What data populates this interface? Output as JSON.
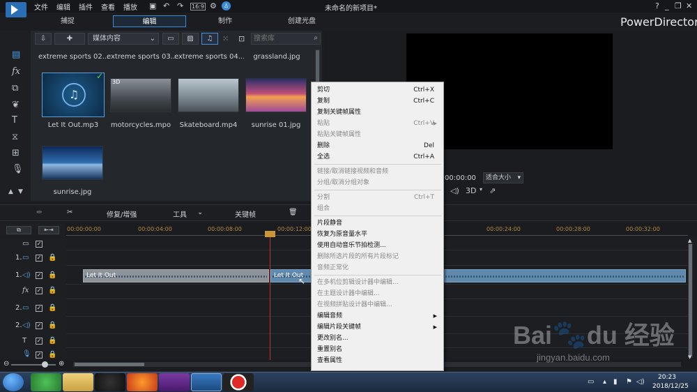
{
  "titlebar": {
    "menus": [
      "文件",
      "编辑",
      "插件",
      "查看",
      "播放"
    ],
    "doc_title": "未命名的新项目*",
    "brand": "PowerDirector",
    "ratio_label": "16:9"
  },
  "mode_tabs": [
    "捕捉",
    "编辑",
    "制作",
    "创建光盘"
  ],
  "library": {
    "content_dropdown": "媒体内容",
    "search_placeholder": "搜索库",
    "top_labels": [
      "extreme sports 02....",
      "extreme sports 03....",
      "extreme sports 04....",
      "grassland.jpg"
    ],
    "items": [
      {
        "label": "Let It Out.mp3",
        "kind": "audio"
      },
      {
        "label": "motorcycles.mpo",
        "kind": "video",
        "badge": "3D"
      },
      {
        "label": "Skateboard.mp4",
        "kind": "video"
      },
      {
        "label": "sunrise 01.jpg",
        "kind": "image"
      },
      {
        "label": "sunrise.jpg",
        "kind": "image"
      }
    ]
  },
  "preview": {
    "timecode": "00:00:00",
    "fit_label": "适合大小",
    "mode_3d": "3D"
  },
  "edit_toolbar": {
    "fix_label": "修复/增强",
    "tools_label": "工具",
    "keyframe_label": "关键帧"
  },
  "timeline": {
    "ruler": [
      "00:00:00:00",
      "00:00:04:00",
      "00:00:08:00",
      "00:00:12:00",
      "00:00:24:00",
      "00:00:28:00",
      "00:00:32:00"
    ],
    "tracks": [
      {
        "num": "",
        "icon": "▭"
      },
      {
        "num": "1.",
        "icon": "▭"
      },
      {
        "num": "1.",
        "icon": "◁)"
      },
      {
        "num": "",
        "icon": "fx"
      },
      {
        "num": "2.",
        "icon": "▭"
      },
      {
        "num": "2.",
        "icon": "◁)"
      },
      {
        "num": "",
        "icon": "T"
      },
      {
        "num": "",
        "icon": "🎙"
      },
      {
        "num": "",
        "icon": "♪"
      }
    ],
    "clip1_label": "Let It Out",
    "clip2_label": "Let It Out"
  },
  "context_menu": {
    "items": [
      {
        "label": "剪切",
        "shortcut": "Ctrl+X",
        "disabled": false
      },
      {
        "label": "复制",
        "shortcut": "Ctrl+C",
        "disabled": false
      },
      {
        "label": "复制关键帧属性",
        "shortcut": "",
        "disabled": false
      },
      {
        "label": "粘贴",
        "shortcut": "Ctrl+V",
        "disabled": true,
        "submenu": true
      },
      {
        "label": "粘贴关键帧属性",
        "shortcut": "",
        "disabled": true
      },
      {
        "label": "删除",
        "shortcut": "Del",
        "disabled": false
      },
      {
        "label": "全选",
        "shortcut": "Ctrl+A",
        "disabled": false
      },
      {
        "sep": true
      },
      {
        "label": "链接/取消链接视频和音频",
        "shortcut": "",
        "disabled": true
      },
      {
        "label": "分组/取消分组对象",
        "shortcut": "",
        "disabled": true
      },
      {
        "sep": true
      },
      {
        "label": "分割",
        "shortcut": "Ctrl+T",
        "disabled": true
      },
      {
        "label": "组合",
        "shortcut": "",
        "disabled": true
      },
      {
        "sep": true
      },
      {
        "label": "片段静音",
        "shortcut": "",
        "disabled": false
      },
      {
        "label": "恢复为原音量水平",
        "shortcut": "",
        "disabled": false
      },
      {
        "label": "使用自动音乐节拍检测...",
        "shortcut": "",
        "disabled": false
      },
      {
        "label": "删除所选片段的所有片段标记",
        "shortcut": "",
        "disabled": true
      },
      {
        "label": "音频正常化",
        "shortcut": "",
        "disabled": true
      },
      {
        "sep": true
      },
      {
        "label": "在多机位剪辑设计器中编辑...",
        "shortcut": "",
        "disabled": true
      },
      {
        "label": "在主题设计器中编辑...",
        "shortcut": "",
        "disabled": true
      },
      {
        "label": "在视频拼贴设计器中编辑...",
        "shortcut": "",
        "disabled": true
      },
      {
        "label": "编辑音频",
        "shortcut": "",
        "disabled": false,
        "submenu": true
      },
      {
        "label": "编辑片段关键帧",
        "shortcut": "",
        "disabled": false,
        "submenu": true
      },
      {
        "label": "更改别名...",
        "shortcut": "",
        "disabled": false
      },
      {
        "label": "重置别名",
        "shortcut": "",
        "disabled": false
      },
      {
        "label": "查看属性",
        "shortcut": "",
        "disabled": false
      }
    ]
  },
  "taskbar": {
    "time": "20:23",
    "date": "2018/12/25"
  },
  "watermark": {
    "brand": "Bai du 经验",
    "url": "jingyan.baidu.com"
  },
  "colors": {
    "accent": "#3a8bd8",
    "playhead": "#c8342c",
    "ruler_text": "#b48a3a"
  }
}
